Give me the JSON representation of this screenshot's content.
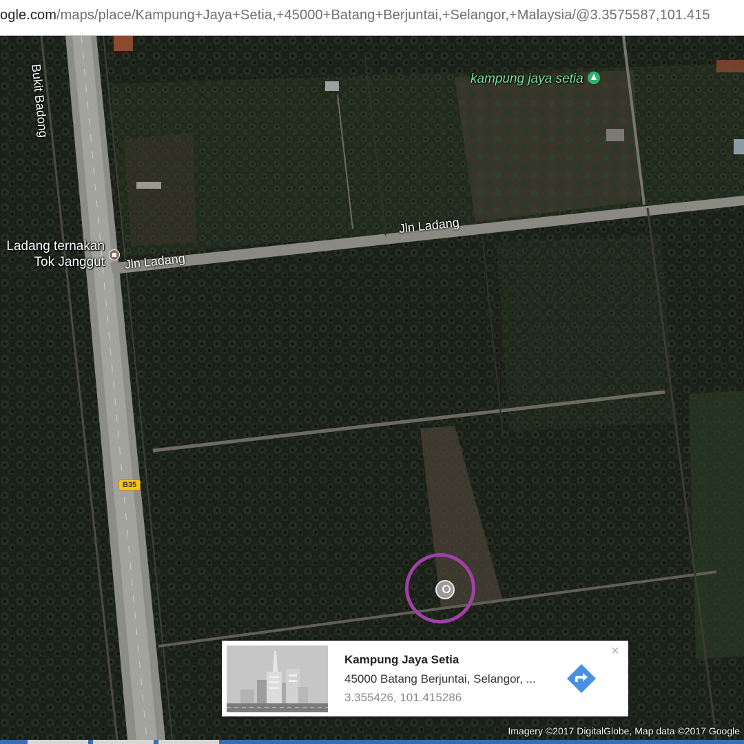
{
  "browser": {
    "url_host": "ogle.com",
    "url_path": "/maps/place/Kampung+Jaya+Setia,+45000+Batang+Berjuntai,+Selangor,+Malaysia/@3.3575587,101.415"
  },
  "map": {
    "view": "satellite",
    "labels": {
      "road_bukit_badong": "Bukit Badong",
      "poi_line1": "Ladang ternakan",
      "poi_line2": "Tok Janggut",
      "village": "kampung jaya setia",
      "road_jln_ladang_1": "Jln Ladang",
      "road_jln_ladang_2": "Jln Ladang",
      "route_shield": "B35"
    },
    "attribution": "Imagery ©2017 DigitalGlobe, Map data ©2017 Google",
    "colors": {
      "highlight_ring": "#a23fa8",
      "directions": "#4a90e2",
      "village_label": "#7ee0a0"
    }
  },
  "place_card": {
    "name": "Kampung Jaya Setia",
    "address": "45000 Batang Berjuntai, Selangor, ...",
    "coordinates": "3.355426, 101.415286",
    "close_label": "×",
    "directions_icon": "directions-icon"
  }
}
